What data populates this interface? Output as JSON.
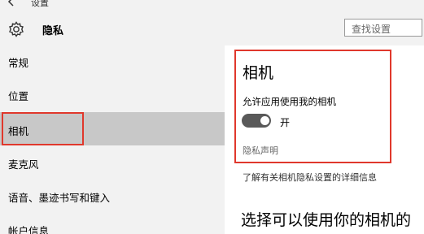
{
  "window": {
    "title": "设置"
  },
  "header": {
    "title": "隐私",
    "search": {
      "placeholder": "查找设置"
    }
  },
  "sidebar": {
    "items": [
      {
        "label": "常规"
      },
      {
        "label": "位置"
      },
      {
        "label": "相机",
        "selected": true
      },
      {
        "label": "麦克风"
      },
      {
        "label": "语音、墨迹书写和键入"
      },
      {
        "label": "帐户信息"
      }
    ]
  },
  "main": {
    "section_title": "相机",
    "allow_label": "允许应用使用我的相机",
    "toggle_state": "开",
    "toggle_on": true,
    "privacy_link": "隐私声明",
    "learn_more": "了解有关相机隐私设置的详细信息",
    "choose_heading": "选择可以使用你的相机的"
  },
  "colors": {
    "highlight_border": "#e0382c",
    "selected_nav": "#c8c8c8",
    "sidebar_bg": "#f2f2f2",
    "toggle_on": "#595959"
  }
}
